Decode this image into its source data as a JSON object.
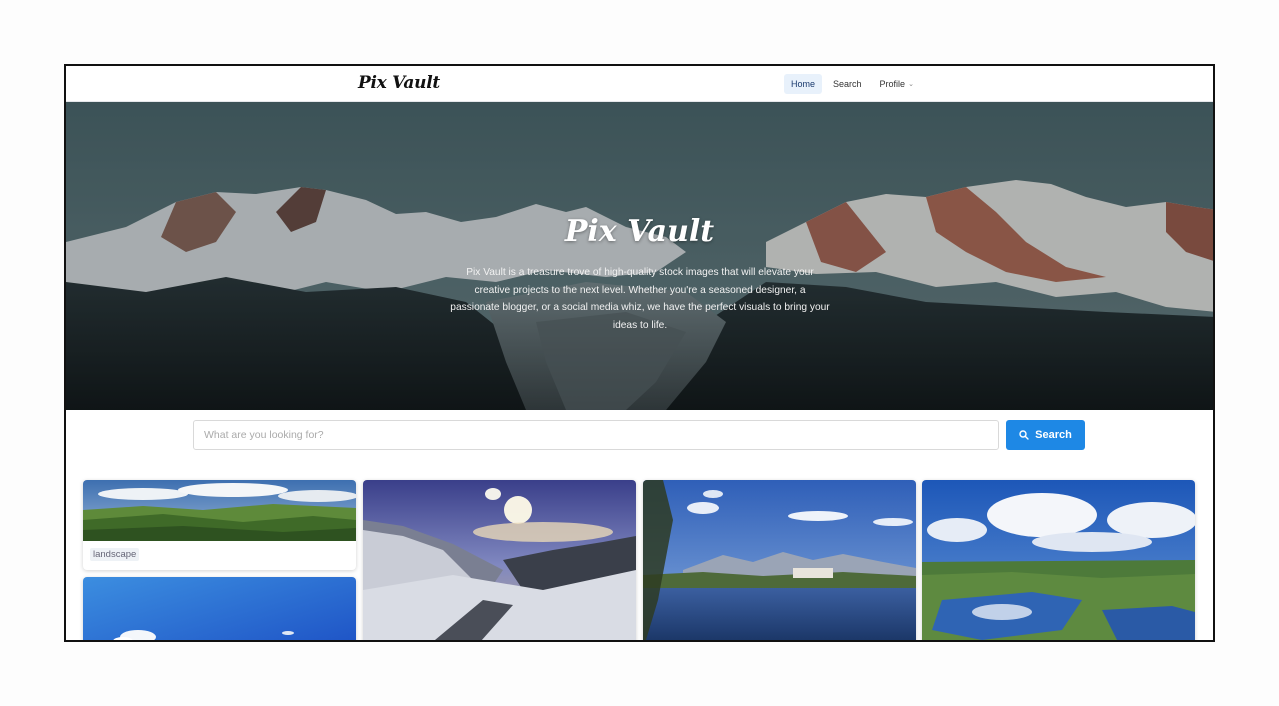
{
  "app": {
    "brand": "Pix Vault"
  },
  "nav": {
    "items": [
      {
        "label": "Home",
        "active": true
      },
      {
        "label": "Search",
        "active": false
      },
      {
        "label": "Profile",
        "active": false,
        "dropdown": true
      }
    ]
  },
  "hero": {
    "title": "Pix Vault",
    "description": "Pix Vault is a treasure trove of high-quality stock images that will elevate your creative projects to the next level. Whether you're a seasoned designer, a passionate blogger, or a social media whiz, we have the perfect visuals to bring your ideas to life."
  },
  "search": {
    "placeholder": "What are you looking for?",
    "value": "",
    "button_label": "Search",
    "button_icon": "search-icon"
  },
  "gallery": {
    "cards": [
      {
        "tag": "landscape",
        "subject": "green-hills"
      },
      {
        "subject": "snowy-valley"
      },
      {
        "subject": "mountain-lake-village"
      },
      {
        "subject": "cloud-reflection-marsh"
      },
      {
        "subject": "blue-sky"
      }
    ]
  },
  "colors": {
    "accent": "#1e88e5",
    "nav_active_bg": "#e8f1fb",
    "frame_border": "#111111"
  }
}
